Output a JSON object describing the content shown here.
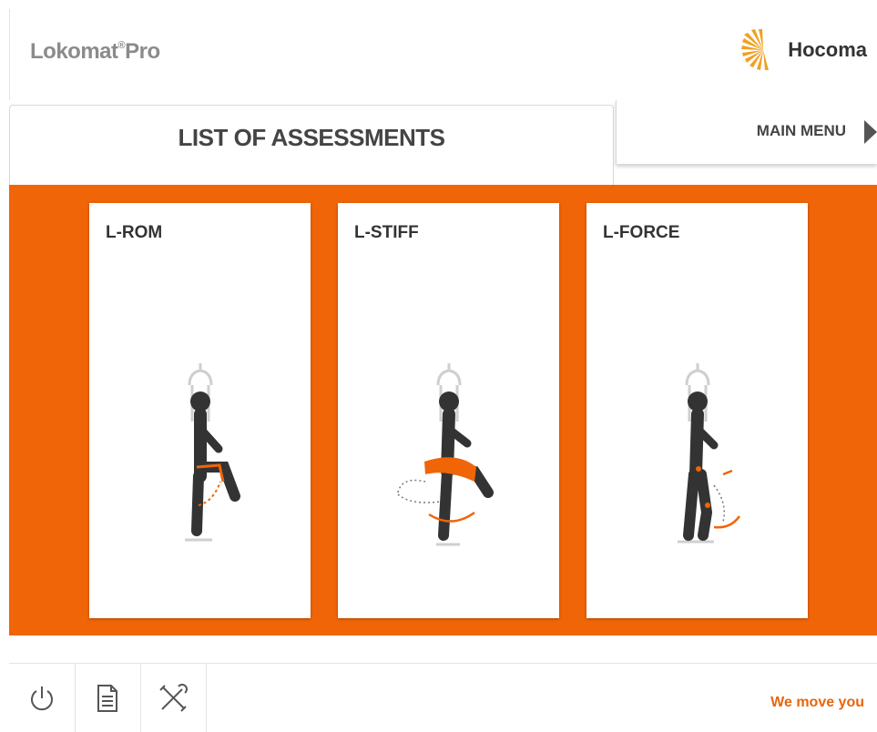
{
  "header": {
    "brand": "Lokomat",
    "brand_reg": "®",
    "brand_suffix": "Pro",
    "logo_text": "Hocoma"
  },
  "tabs": {
    "active_label": "LIST OF ASSESSMENTS",
    "main_menu_label": "MAIN MENU"
  },
  "assessments": [
    {
      "title": "L-ROM"
    },
    {
      "title": "L-STIFF"
    },
    {
      "title": "L-FORCE"
    }
  ],
  "footer": {
    "tagline": "We move you",
    "buttons": [
      "power-icon",
      "document-icon",
      "tools-icon"
    ]
  },
  "colors": {
    "accent": "#f06508",
    "text": "#444444",
    "brand_grey": "#8b8b8b",
    "tagline": "#e8650a"
  }
}
